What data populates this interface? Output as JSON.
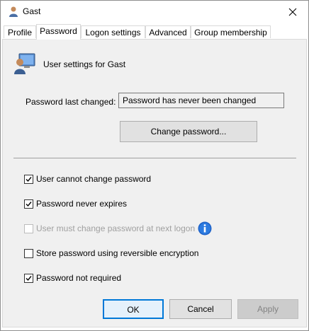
{
  "window": {
    "title": "Gast"
  },
  "tabs": [
    {
      "label": "Profile"
    },
    {
      "label": "Password"
    },
    {
      "label": "Logon settings"
    },
    {
      "label": "Advanced"
    },
    {
      "label": "Group membership"
    }
  ],
  "active_tab": "Password",
  "header": {
    "text": "User settings for Gast",
    "icon": "user-monitor-icon"
  },
  "password": {
    "last_changed_label": "Password last changed:",
    "last_changed_value": "Password has never been changed",
    "change_button": "Change password..."
  },
  "options": [
    {
      "label": "User cannot change password",
      "checked": true,
      "enabled": true
    },
    {
      "label": "Password never expires",
      "checked": true,
      "enabled": true
    },
    {
      "label": "User must change password at next logon",
      "checked": false,
      "enabled": false
    },
    {
      "label": "Store password using reversible encryption",
      "checked": false,
      "enabled": true
    },
    {
      "label": "Password not required",
      "checked": true,
      "enabled": true
    }
  ],
  "buttons": {
    "ok": "OK",
    "cancel": "Cancel",
    "apply": "Apply"
  },
  "colors": {
    "accent": "#0078d7",
    "panel": "#f0f0f0",
    "info": "#1e62c8"
  }
}
